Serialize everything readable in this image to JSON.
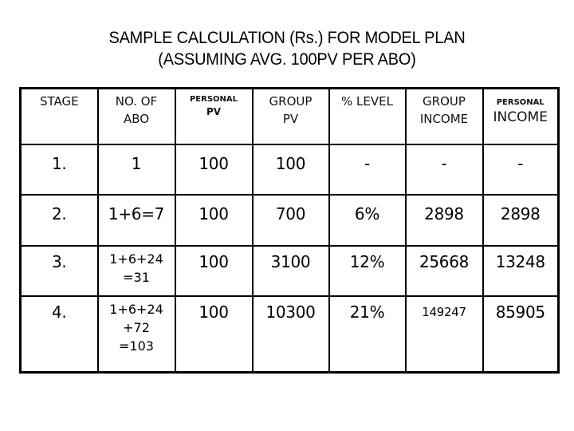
{
  "title": {
    "line1": "SAMPLE CALCULATION (Rs.) FOR MODEL PLAN",
    "line2": "(ASSUMING AVG. 100PV PER ABO)"
  },
  "table": {
    "headers": {
      "stage": "STAGE",
      "no_of_abo": [
        "NO. OF",
        "ABO"
      ],
      "personal_pv": [
        "PERSONAL",
        "PV"
      ],
      "group_pv": [
        "GROUP",
        "PV"
      ],
      "percent_level": "% LEVEL",
      "group_income": [
        "GROUP",
        "INCOME"
      ],
      "personal_income": [
        "PERSONAL",
        "INCOME"
      ]
    },
    "rows": [
      {
        "stage": "1.",
        "no_of_abo": [
          "1"
        ],
        "personal_pv": "100",
        "group_pv": "100",
        "percent_level": "-",
        "group_income": "-",
        "personal_income": "-"
      },
      {
        "stage": "2.",
        "no_of_abo": [
          "1+6=7"
        ],
        "personal_pv": "100",
        "group_pv": "700",
        "percent_level": "6%",
        "group_income": "2898",
        "personal_income": "2898"
      },
      {
        "stage": "3.",
        "no_of_abo": [
          "1+6+24",
          "=31"
        ],
        "personal_pv": "100",
        "group_pv": "3100",
        "percent_level": "12%",
        "group_income": "25668",
        "personal_income": "13248"
      },
      {
        "stage": "4.",
        "no_of_abo": [
          "1+6+24",
          "+72",
          "=103"
        ],
        "personal_pv": "100",
        "group_pv": "10300",
        "percent_level": "21%",
        "group_income": "149247",
        "personal_income": "85905"
      }
    ]
  }
}
